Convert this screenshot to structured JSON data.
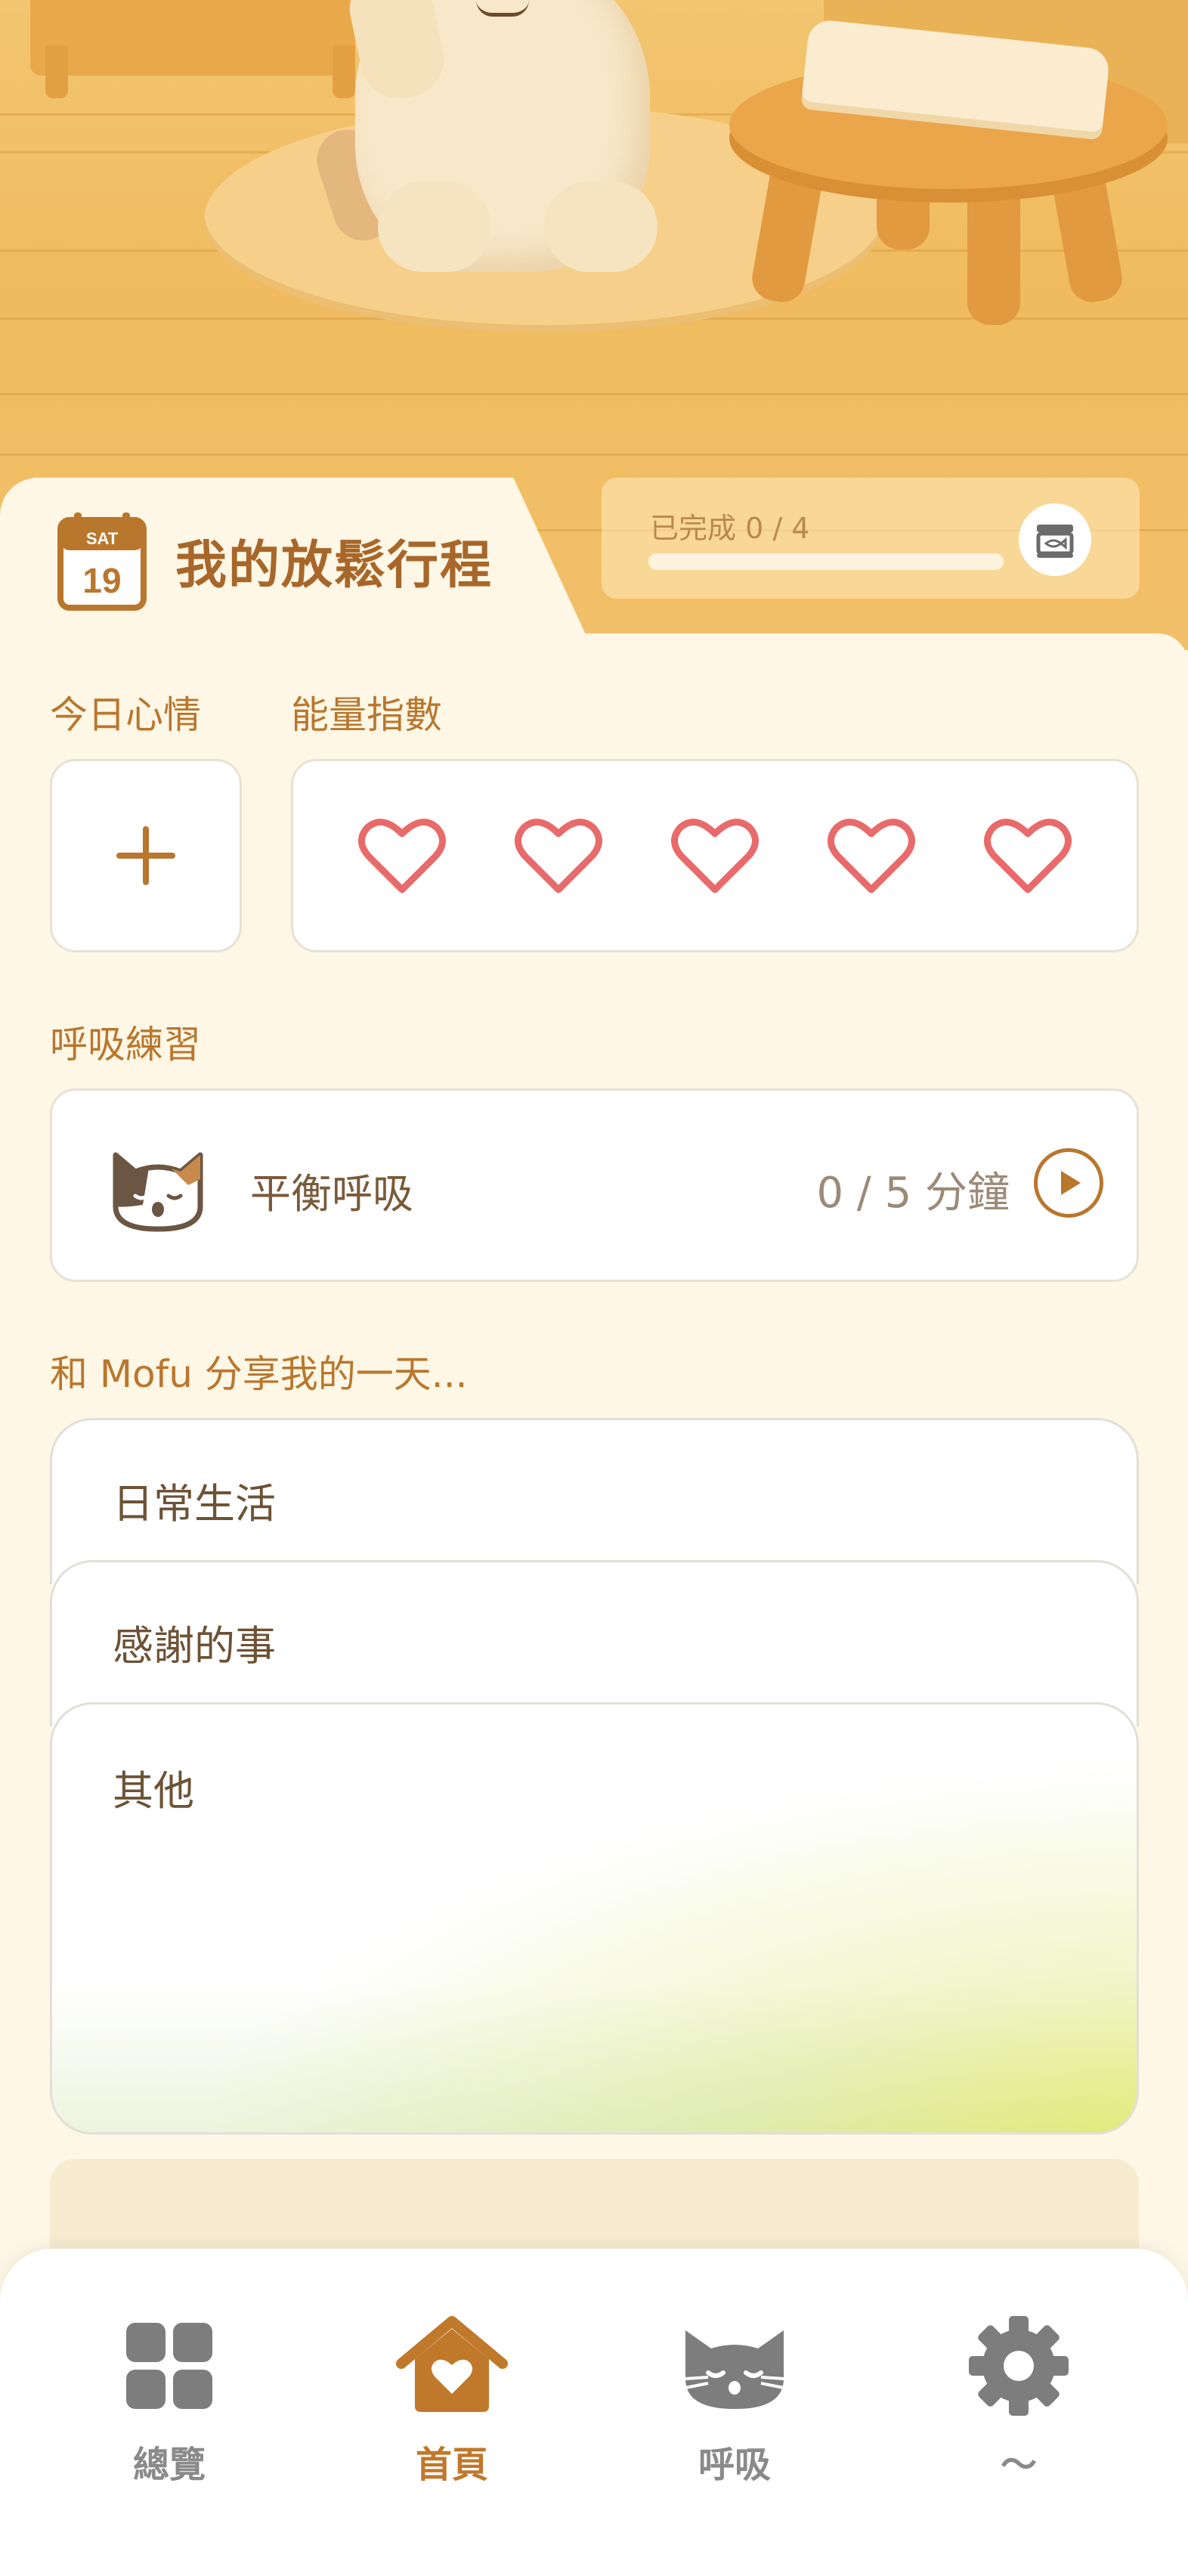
{
  "header": {
    "calendar": {
      "weekday": "SAT",
      "day": "19"
    },
    "title": "我的放鬆行程",
    "progress": {
      "label": "已完成 0 / 4",
      "completed": 0,
      "total": 4,
      "icon": "fish-can-icon"
    }
  },
  "mood": {
    "label": "今日心情",
    "add_icon": "plus-icon"
  },
  "energy": {
    "label": "能量指數",
    "hearts": [
      {
        "icon": "heart-outline-icon"
      },
      {
        "icon": "heart-outline-icon"
      },
      {
        "icon": "heart-outline-icon"
      },
      {
        "icon": "heart-outline-icon"
      },
      {
        "icon": "heart-outline-icon"
      }
    ],
    "heart_color": "#e86a6a"
  },
  "breathing": {
    "label": "呼吸練習",
    "name": "平衡呼吸",
    "progress": "0 / 5 分鐘",
    "play_icon": "play-icon"
  },
  "journal": {
    "label": "和 Mofu 分享我的一天...",
    "entries": [
      "日常生活",
      "感謝的事",
      "其他"
    ]
  },
  "nav": {
    "items": [
      {
        "label": "總覽",
        "icon": "grid-icon",
        "active": false
      },
      {
        "label": "首頁",
        "icon": "home-heart-icon",
        "active": true
      },
      {
        "label": "呼吸",
        "icon": "cat-face-icon",
        "active": false
      },
      {
        "label": "～",
        "icon": "gear-icon",
        "active": false
      }
    ]
  },
  "colors": {
    "accent": "#b9772e",
    "title": "#a8672a",
    "heart": "#e86a6a",
    "background": "#fef7e6",
    "nav_inactive": "#8a8a8a"
  }
}
